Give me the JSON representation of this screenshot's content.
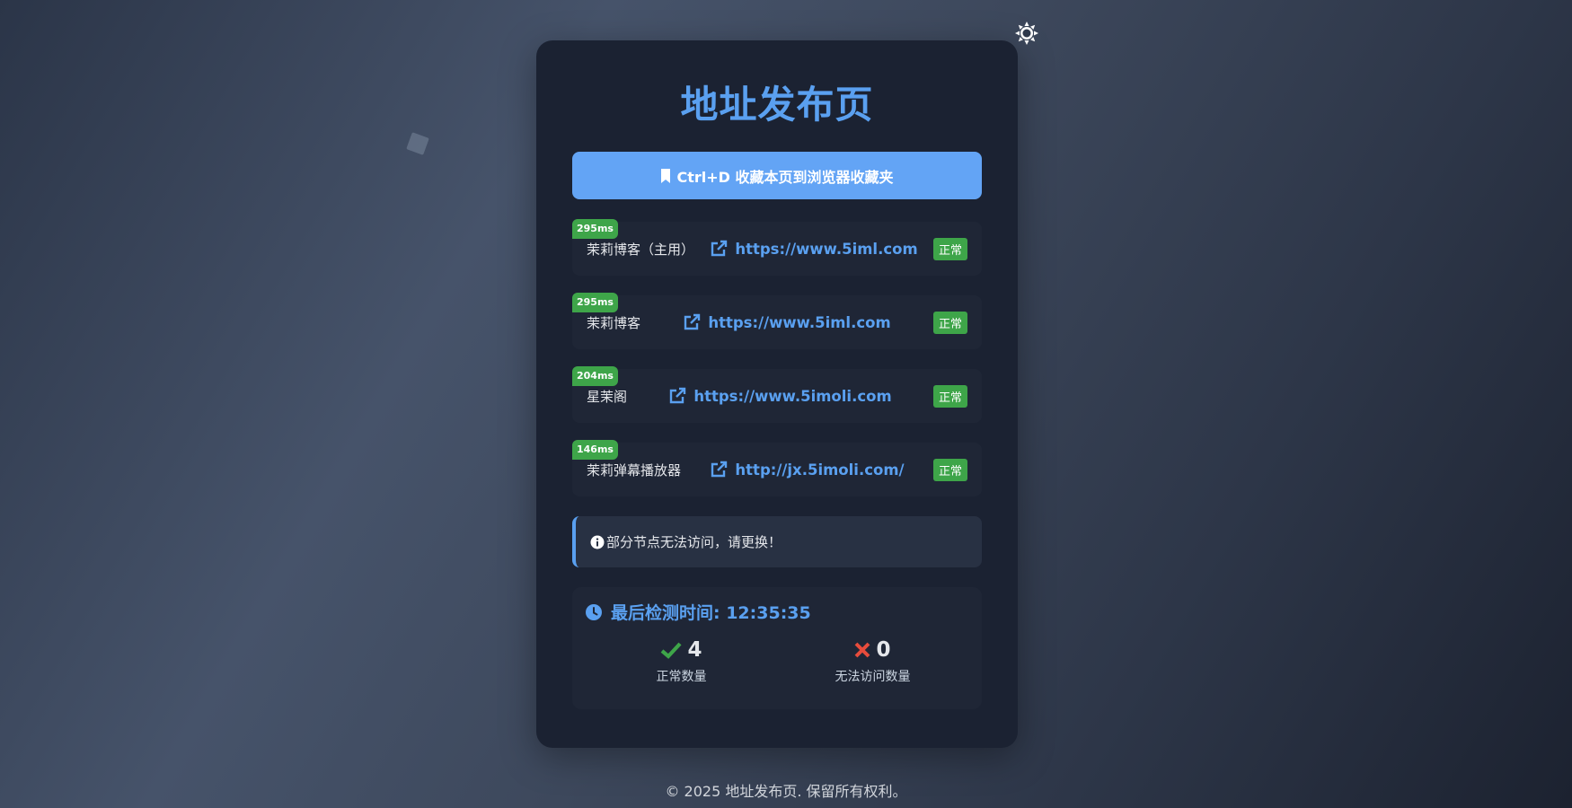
{
  "page": {
    "title": "地址发布页",
    "bookmark_button": "Ctrl+D 收藏本页到浏览器收藏夹",
    "footer": "© 2025 地址发布页. 保留所有权利。"
  },
  "links": [
    {
      "latency": "295ms",
      "name": "茉莉博客（主用）",
      "url": "https://www.5iml.com",
      "status": "正常"
    },
    {
      "latency": "295ms",
      "name": "茉莉博客",
      "url": "https://www.5iml.com",
      "status": "正常"
    },
    {
      "latency": "204ms",
      "name": "星茉阁",
      "url": "https://www.5imoli.com",
      "status": "正常"
    },
    {
      "latency": "146ms",
      "name": "茉莉弹幕播放器",
      "url": "http://jx.5imoli.com/",
      "status": "正常"
    }
  ],
  "notice": "部分节点无法访问，请更换！",
  "stats": {
    "last_check": "最后检测时间: 12:35:35",
    "ok_count": "4",
    "ok_label": "正常数量",
    "fail_count": "0",
    "fail_label": "无法访问数量"
  },
  "colors": {
    "accent": "#5aa0f0",
    "button": "#63a4f5",
    "ok": "#3ea549",
    "fail": "#e74c3c",
    "card": "#1b2232"
  },
  "icons": {
    "theme": "sun-icon",
    "bookmark": "bookmark-icon",
    "link": "external-link-icon",
    "info": "info-icon",
    "clock": "clock-icon",
    "ok": "check-icon",
    "fail": "x-icon"
  }
}
